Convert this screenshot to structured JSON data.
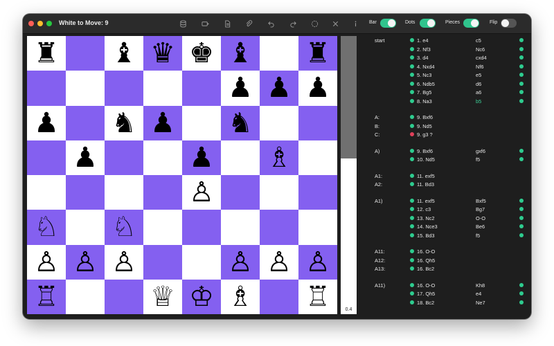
{
  "window": {
    "title": "White to Move: 9"
  },
  "toolbar": {
    "icons": [
      "database-icon",
      "tag-icon",
      "document-icon",
      "paperclip-icon",
      "undo-icon",
      "redo-icon",
      "circle-icon",
      "close-icon",
      "info-icon"
    ],
    "toggles": [
      {
        "label": "Bar",
        "on": true
      },
      {
        "label": "Dots",
        "on": true
      },
      {
        "label": "Pieces",
        "on": true
      },
      {
        "label": "Flip",
        "on": false
      }
    ]
  },
  "board": {
    "colors": {
      "light": "#ffffff",
      "dark": "#8460f0"
    },
    "rows": [
      [
        "♜",
        "",
        "♝",
        "♛",
        "♚",
        "♝",
        "",
        "♜"
      ],
      [
        "",
        "",
        "",
        "",
        "",
        "♟",
        "♟",
        "♟"
      ],
      [
        "♟",
        "",
        "♞",
        "♟",
        "",
        "♞",
        "",
        ""
      ],
      [
        "",
        "♟",
        "",
        "",
        "♟",
        "",
        "♗",
        ""
      ],
      [
        "",
        "",
        "",
        "",
        "♙",
        "",
        "",
        ""
      ],
      [
        "♘",
        "",
        "♘",
        "",
        "",
        "",
        "",
        ""
      ],
      [
        "♙",
        "♙",
        "♙",
        "",
        "",
        "♙",
        "♙",
        "♙"
      ],
      [
        "♖",
        "",
        "",
        "♕",
        "♔",
        "♗",
        "",
        "♖"
      ]
    ]
  },
  "eval": {
    "value": "0.4",
    "white_fraction": 0.56
  },
  "moves": [
    {
      "label": "start",
      "dot": "g",
      "white": "1. e4",
      "black": "c5",
      "black_dot": "g"
    },
    {
      "label": "",
      "dot": "g",
      "white": "2. Nf3",
      "black": "Nc6",
      "black_dot": "g"
    },
    {
      "label": "",
      "dot": "g",
      "white": "3. d4",
      "black": "cxd4",
      "black_dot": "g"
    },
    {
      "label": "",
      "dot": "g",
      "white": "4. Nxd4",
      "black": "Nf6",
      "black_dot": "g"
    },
    {
      "label": "",
      "dot": "g",
      "white": "5. Nc3",
      "black": "e5",
      "black_dot": "g"
    },
    {
      "label": "",
      "dot": "g",
      "white": "6. Ndb5",
      "black": "d6",
      "black_dot": "g"
    },
    {
      "label": "",
      "dot": "g",
      "white": "7. Bg5",
      "black": "a6",
      "black_dot": "g"
    },
    {
      "label": "",
      "dot": "g",
      "white": "8. Na3",
      "black": "b5",
      "black_dot": "g",
      "highlight": true
    },
    {
      "gap": true
    },
    {
      "label": "A:",
      "dot": "g",
      "white": "9. Bxf6"
    },
    {
      "label": "B:",
      "dot": "g",
      "white": "9. Nd5"
    },
    {
      "label": "C:",
      "dot": "r",
      "white": "9. g3 ?"
    },
    {
      "gap": true
    },
    {
      "label": "A)",
      "dot": "g",
      "white": "9. Bxf6",
      "black": "gxf6",
      "black_dot": "g"
    },
    {
      "label": "",
      "dot": "g",
      "white": "10. Nd5",
      "black": "f5",
      "black_dot": "g"
    },
    {
      "gap": true
    },
    {
      "label": "A1:",
      "dot": "g",
      "white": "11. exf5"
    },
    {
      "label": "A2:",
      "dot": "g",
      "white": "11. Bd3"
    },
    {
      "gap": true
    },
    {
      "label": "A1)",
      "dot": "g",
      "white": "11. exf5",
      "black": "Bxf5",
      "black_dot": "g"
    },
    {
      "label": "",
      "dot": "g",
      "white": "12. c3",
      "black": "Bg7",
      "black_dot": "g"
    },
    {
      "label": "",
      "dot": "g",
      "white": "13. Nc2",
      "black": "O-O",
      "black_dot": "g"
    },
    {
      "label": "",
      "dot": "g",
      "white": "14. Nce3",
      "black": "Be6",
      "black_dot": "g"
    },
    {
      "label": "",
      "dot": "g",
      "white": "15. Bd3",
      "black": "f5",
      "black_dot": "g"
    },
    {
      "gap": true
    },
    {
      "label": "A11:",
      "dot": "g",
      "white": "16. O-O"
    },
    {
      "label": "A12:",
      "dot": "g",
      "white": "16. Qh5"
    },
    {
      "label": "A13:",
      "dot": "g",
      "white": "16. Bc2"
    },
    {
      "gap": true
    },
    {
      "label": "A11)",
      "dot": "g",
      "white": "16. O-O",
      "black": "Kh8",
      "black_dot": "g"
    },
    {
      "label": "",
      "dot": "g",
      "white": "17. Qh5",
      "black": "e4",
      "black_dot": "g"
    },
    {
      "label": "",
      "dot": "g",
      "white": "18. Bc2",
      "black": "Ne7",
      "black_dot": "g"
    }
  ]
}
